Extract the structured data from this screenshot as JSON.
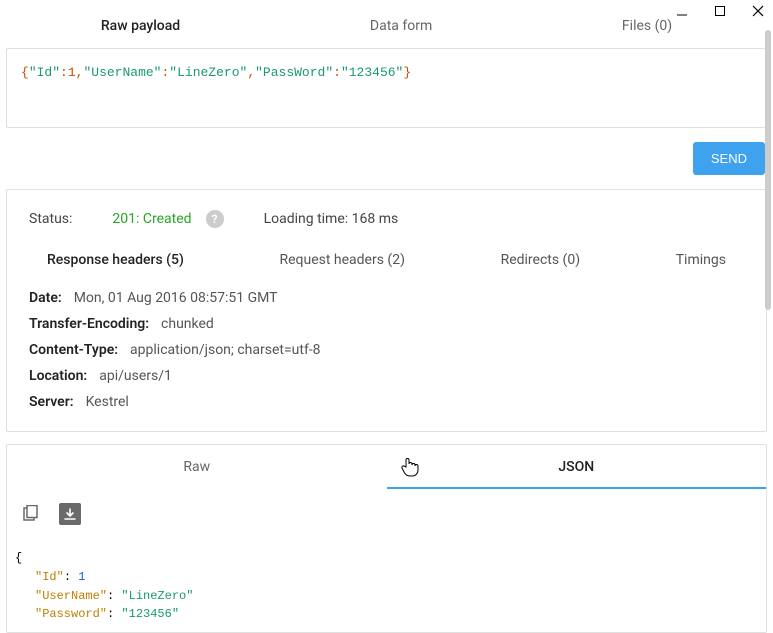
{
  "window_controls": {
    "minimize": "minimize",
    "maximize": "maximize",
    "close": "close"
  },
  "request_tabs": {
    "raw_payload": "Raw payload",
    "data_form": "Data form",
    "files": "Files (0)"
  },
  "payload_tokens": {
    "open": "{",
    "id_key": "\"Id\"",
    "id_val": "1",
    "user_key": "\"UserName\"",
    "user_val": "\"LineZero\"",
    "pass_key": "\"PassWord\"",
    "pass_val": "\"123456\"",
    "close": "}",
    "colon": ":",
    "comma": ","
  },
  "send_label": "SEND",
  "status": {
    "label": "Status:",
    "code": "201: Created",
    "help": "?",
    "loading": "Loading time: 168 ms"
  },
  "sub_tabs": {
    "response_headers": "Response headers (5)",
    "request_headers": "Request headers (2)",
    "redirects": "Redirects (0)",
    "timings": "Timings"
  },
  "headers": [
    {
      "k": "Date:",
      "v": "Mon, 01 Aug 2016 08:57:51 GMT"
    },
    {
      "k": "Transfer-Encoding:",
      "v": "chunked"
    },
    {
      "k": "Content-Type:",
      "v": "application/json; charset=utf-8"
    },
    {
      "k": "Location:",
      "v": "api/users/1"
    },
    {
      "k": "Server:",
      "v": "Kestrel"
    }
  ],
  "resp_tabs": {
    "raw": "Raw",
    "json": "JSON"
  },
  "json_body": {
    "open": "{",
    "id_k": "\"Id\"",
    "id_v": "1",
    "user_k": "\"UserName\"",
    "user_v": "\"LineZero\"",
    "pass_k": "\"Password\"",
    "pass_v": "\"123456\"",
    "colon": ": "
  }
}
